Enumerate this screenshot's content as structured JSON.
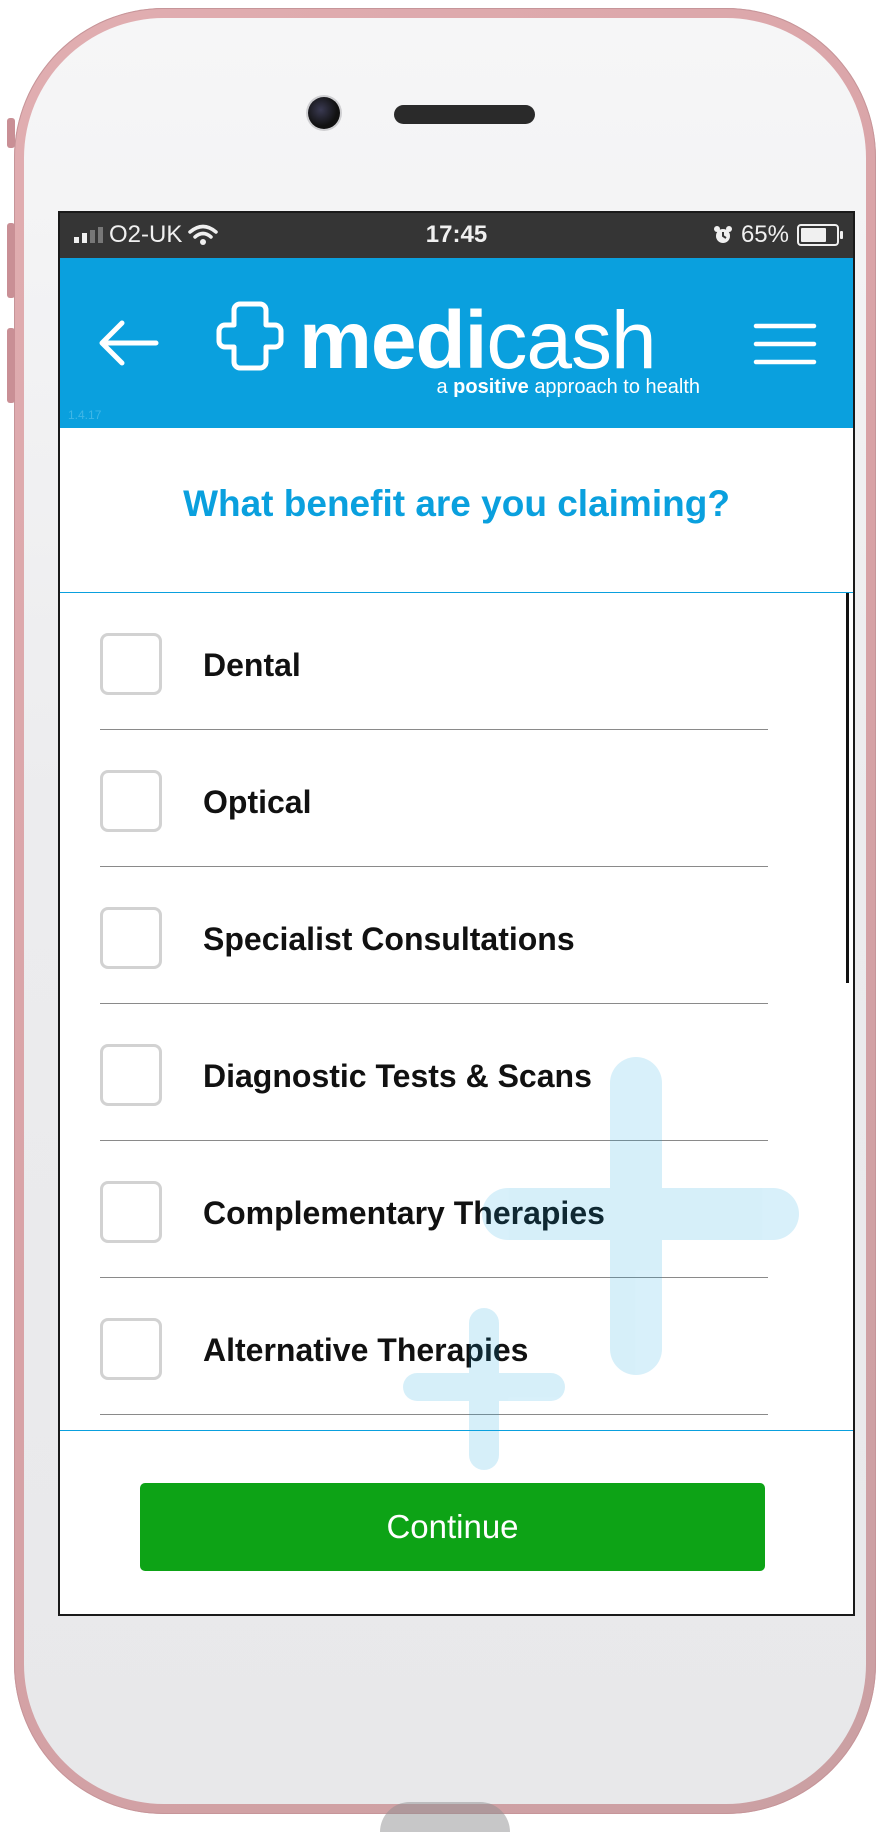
{
  "status_bar": {
    "carrier": "O2-UK",
    "time": "17:45",
    "battery": "65%",
    "battery_level": 0.65
  },
  "header": {
    "logo_text_bold": "medi",
    "logo_text_light": "cash",
    "tagline_prefix": "a",
    "tagline_bold": "positive",
    "tagline_suffix": "approach to health",
    "version": "1.4.17",
    "brand_color": "#0aa0de"
  },
  "page": {
    "question": "What benefit are you claiming?"
  },
  "benefits": [
    {
      "label": "Dental",
      "checked": false
    },
    {
      "label": "Optical",
      "checked": false
    },
    {
      "label": "Specialist Consultations",
      "checked": false
    },
    {
      "label": "Diagnostic Tests & Scans",
      "checked": false
    },
    {
      "label": "Complementary Therapies",
      "checked": false
    },
    {
      "label": "Alternative Therapies",
      "checked": false
    }
  ],
  "footer": {
    "continue_label": "Continue",
    "button_color": "#0da316"
  },
  "icons": {
    "back": "arrow-left-icon",
    "menu": "hamburger-menu-icon",
    "logo": "medicash-cross-logo-icon"
  }
}
